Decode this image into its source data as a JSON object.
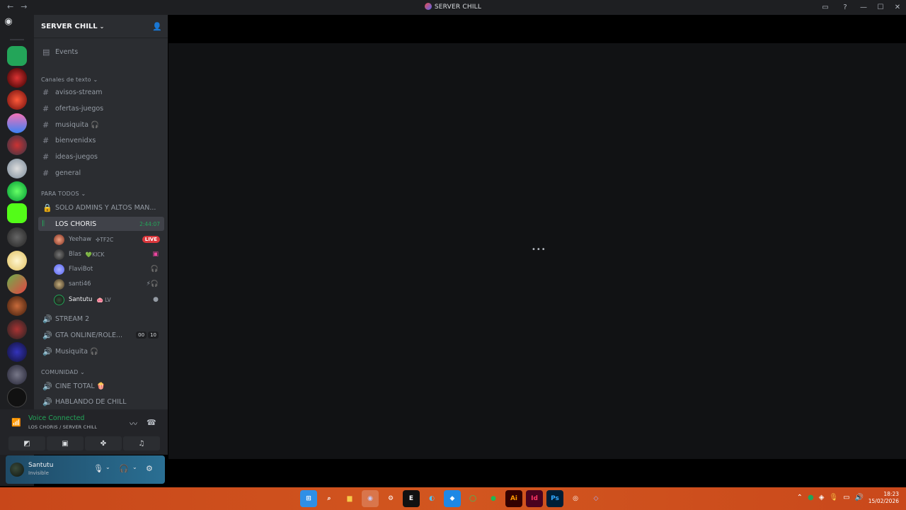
{
  "window": {
    "title": "SERVER CHILL",
    "back": "←",
    "forward": "→"
  },
  "server": {
    "name": "SERVER CHILL"
  },
  "channels": {
    "events": "Events",
    "text_category": "Canales de texto",
    "text_channels": [
      "avisos-stream",
      "ofertas-juegos",
      "musiquita 🎧",
      "bienvenidxs",
      "ideas-juegos",
      "general"
    ],
    "para_todos_category": "PARA TODOS",
    "locked_channel": "SOLO ADMINS Y ALTOS MAN...",
    "active_voice": "LOS CHORIS",
    "active_timer": "2:44:07",
    "voice_users": [
      {
        "name": "Yeehaw",
        "extra": "✣TF2C",
        "badge": "LIVE"
      },
      {
        "name": "Blas",
        "extra": "💚KICK"
      },
      {
        "name": "FlaviBot",
        "extra": ""
      },
      {
        "name": "santi46",
        "extra": ""
      },
      {
        "name": "Santutu",
        "extra": "🐽 LV"
      }
    ],
    "stream2": "STREAM 2",
    "gta": "GTA ONLINE/ROLE...",
    "gta_counts": [
      "00",
      "10"
    ],
    "musiquita_voice": "Musiquita 🎧",
    "comunidad_category": "COMUNIDAD",
    "cine": "CINE TOTAL 🍿",
    "hablando": "HABLANDO DE CHILL"
  },
  "voice": {
    "title": "Voice Connected",
    "subtitle": "LOS CHORIS / SERVER CHILL"
  },
  "user": {
    "name": "Santutu",
    "status": "Invisible"
  },
  "clock": {
    "time": "18:23",
    "date": "15/02/2026"
  },
  "colors": {
    "accent_green": "#23a559",
    "live_red": "#da373c",
    "taskbar": "#d2561f"
  }
}
